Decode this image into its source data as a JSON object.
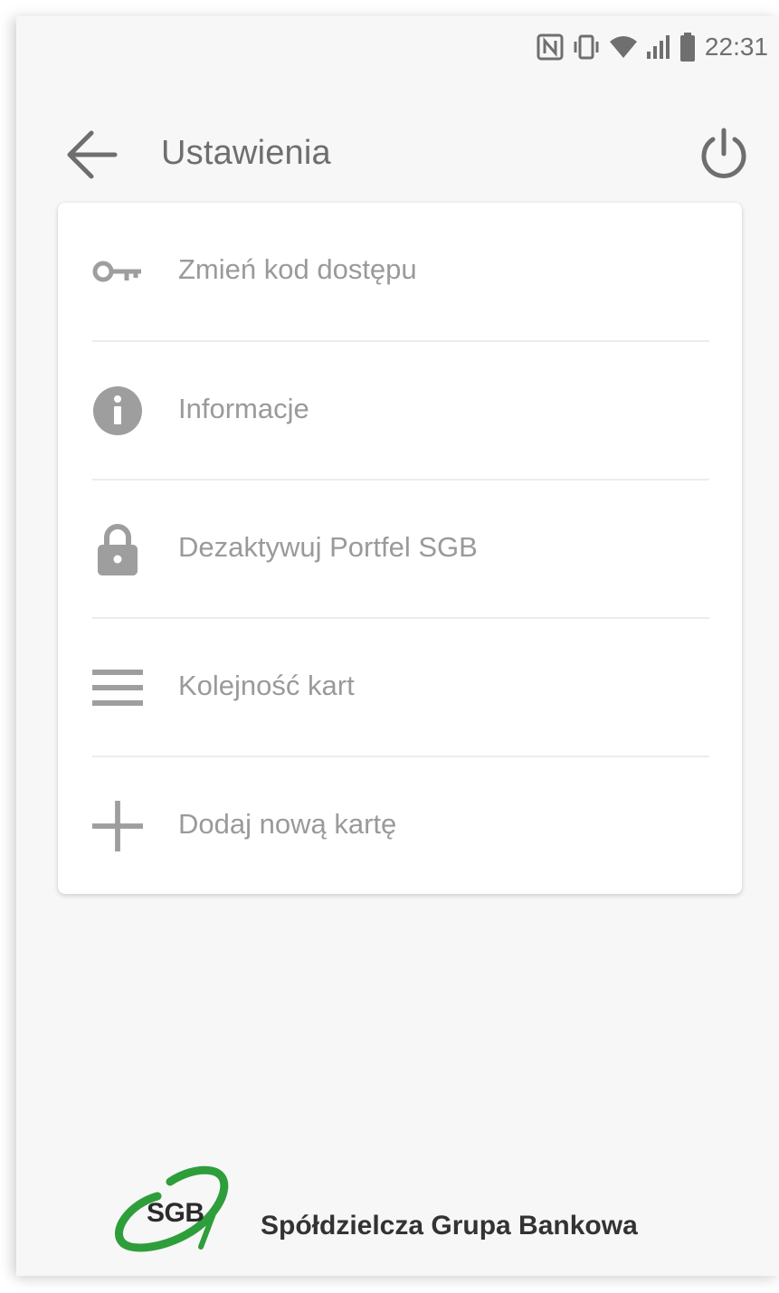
{
  "status_bar": {
    "time": "22:31",
    "icons": [
      "nfc-icon",
      "vibrate-icon",
      "wifi-icon",
      "signal-icon",
      "battery-icon"
    ]
  },
  "toolbar": {
    "title": "Ustawienia",
    "back_icon": "arrow-left-icon",
    "power_icon": "power-icon"
  },
  "menu": {
    "items": [
      {
        "label": "Zmień kod dostępu",
        "icon": "key-icon"
      },
      {
        "label": "Informacje",
        "icon": "info-icon"
      },
      {
        "label": "Dezaktywuj Portfel SGB",
        "icon": "lock-icon"
      },
      {
        "label": "Kolejność kart",
        "icon": "reorder-icon"
      },
      {
        "label": "Dodaj nową kartę",
        "icon": "plus-icon"
      }
    ]
  },
  "footer": {
    "logo_text": "SGB",
    "bank_name": "Spółdzielcza Grupa Bankowa",
    "brand_color": "#2e9e3a"
  },
  "colors": {
    "background": "#f7f7f7",
    "card": "#ffffff",
    "icon_gray": "#9e9e9e",
    "text_gray": "#9a9a9a",
    "title_gray": "#6e6e6e"
  }
}
